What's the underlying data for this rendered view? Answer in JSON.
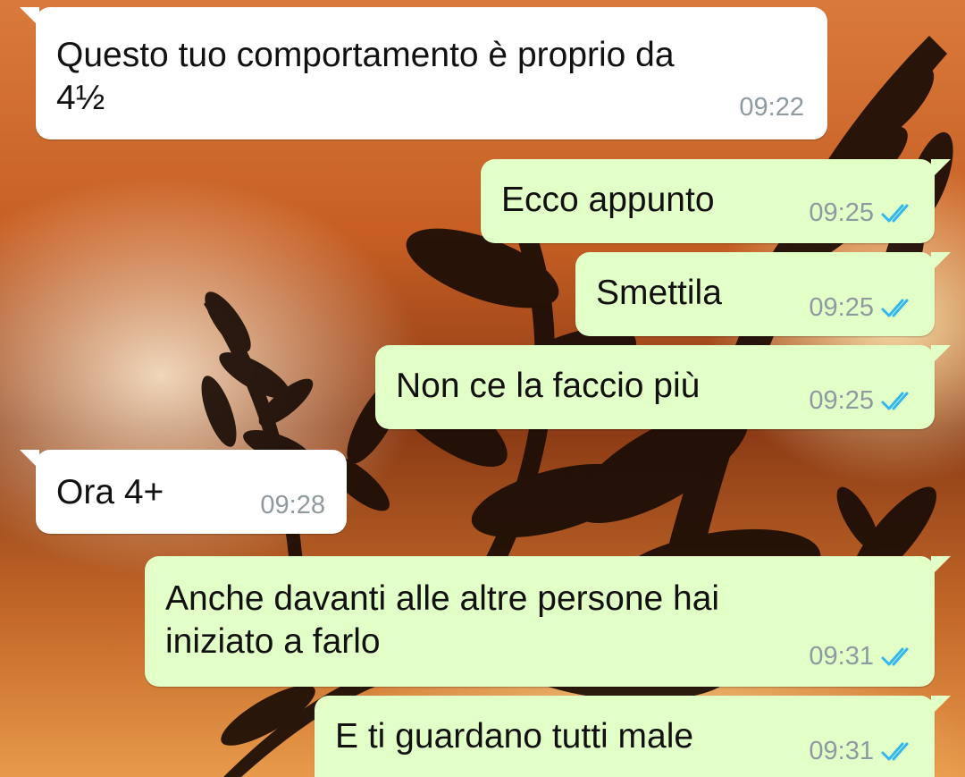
{
  "colors": {
    "incoming_bubble": "#ffffff",
    "outgoing_bubble": "#e2ffc7",
    "timestamp": "#8f9aa0",
    "read_ticks": "#34b7f1"
  },
  "conversation": {
    "messages": [
      {
        "direction": "incoming",
        "text": "Questo tuo comportamento è proprio da\n4½",
        "time": "09:22"
      },
      {
        "direction": "outgoing",
        "text": "Ecco appunto",
        "time": "09:25",
        "status_icon": "double-check-read-icon"
      },
      {
        "direction": "outgoing",
        "text": "Smettila",
        "time": "09:25",
        "status_icon": "double-check-read-icon"
      },
      {
        "direction": "outgoing",
        "text": "Non ce la faccio più",
        "time": "09:25",
        "status_icon": "double-check-read-icon"
      },
      {
        "direction": "incoming",
        "text": "Ora 4+",
        "time": "09:28"
      },
      {
        "direction": "outgoing",
        "text": "Anche davanti alle altre persone hai\niniziato a farlo",
        "time": "09:31",
        "status_icon": "double-check-read-icon"
      },
      {
        "direction": "outgoing",
        "text": "E ti guardano tutti male",
        "time": "09:31",
        "status_icon": "double-check-read-icon"
      }
    ]
  }
}
